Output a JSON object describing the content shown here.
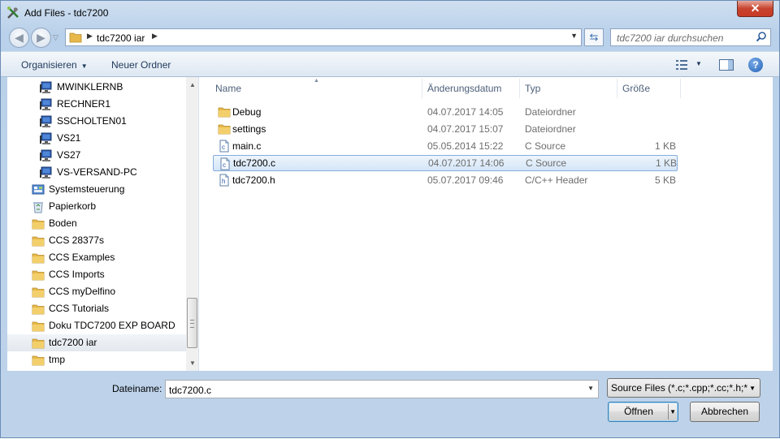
{
  "window": {
    "title": "Add Files - tdc7200",
    "close_label": "✕"
  },
  "address": {
    "crumb": "tdc7200 iar",
    "search_placeholder": "tdc7200 iar durchsuchen"
  },
  "toolbar": {
    "organize_label": "Organisieren",
    "new_folder_label": "Neuer Ordner",
    "help_label": "?"
  },
  "nav": {
    "items": [
      {
        "label": "MWINKLERNB",
        "icon": "computer-icon"
      },
      {
        "label": "RECHNER1",
        "icon": "computer-icon"
      },
      {
        "label": "SSCHOLTEN01",
        "icon": "computer-icon"
      },
      {
        "label": "VS21",
        "icon": "computer-icon"
      },
      {
        "label": "VS27",
        "icon": "computer-icon"
      },
      {
        "label": "VS-VERSAND-PC",
        "icon": "computer-icon"
      },
      {
        "label": "Systemsteuerung",
        "icon": "control-panel-icon"
      },
      {
        "label": "Papierkorb",
        "icon": "recycle-bin-icon"
      },
      {
        "label": "Boden",
        "icon": "folder-icon"
      },
      {
        "label": "CCS 28377s",
        "icon": "folder-icon"
      },
      {
        "label": "CCS Examples",
        "icon": "folder-icon"
      },
      {
        "label": "CCS Imports",
        "icon": "folder-icon"
      },
      {
        "label": "CCS myDelfino",
        "icon": "folder-icon"
      },
      {
        "label": "CCS Tutorials",
        "icon": "folder-icon"
      },
      {
        "label": "Doku TDC7200 EXP BOARD",
        "icon": "folder-icon"
      },
      {
        "label": "tdc7200 iar",
        "icon": "folder-icon"
      },
      {
        "label": "tmp",
        "icon": "folder-icon"
      }
    ]
  },
  "files": {
    "columns": [
      "Name",
      "Änderungsdatum",
      "Typ",
      "Größe"
    ],
    "rows": [
      {
        "name": "Debug",
        "date": "04.07.2017 14:05",
        "type": "Dateiordner",
        "size": "",
        "icon": "folder-icon"
      },
      {
        "name": "settings",
        "date": "04.07.2017 15:07",
        "type": "Dateiordner",
        "size": "",
        "icon": "folder-icon"
      },
      {
        "name": "main.c",
        "date": "05.05.2014 15:22",
        "type": "C Source",
        "size": "1 KB",
        "icon": "c-file-icon"
      },
      {
        "name": "tdc7200.c",
        "date": "04.07.2017 14:06",
        "type": "C Source",
        "size": "1 KB",
        "icon": "c-file-icon",
        "selected": true
      },
      {
        "name": "tdc7200.h",
        "date": "05.07.2017 09:46",
        "type": "C/C++ Header",
        "size": "5 KB",
        "icon": "h-file-icon"
      }
    ]
  },
  "bottom": {
    "filename_label": "Dateiname:",
    "filename_value": "tdc7200.c",
    "filter_value": "Source Files (*.c;*.cpp;*.cc;*.h;*",
    "open_label": "Öffnen",
    "cancel_label": "Abbrechen"
  },
  "colors": {
    "selection": "#cce4f7",
    "title_bar": "#b9d1ea",
    "folder": "#e8b94a"
  }
}
